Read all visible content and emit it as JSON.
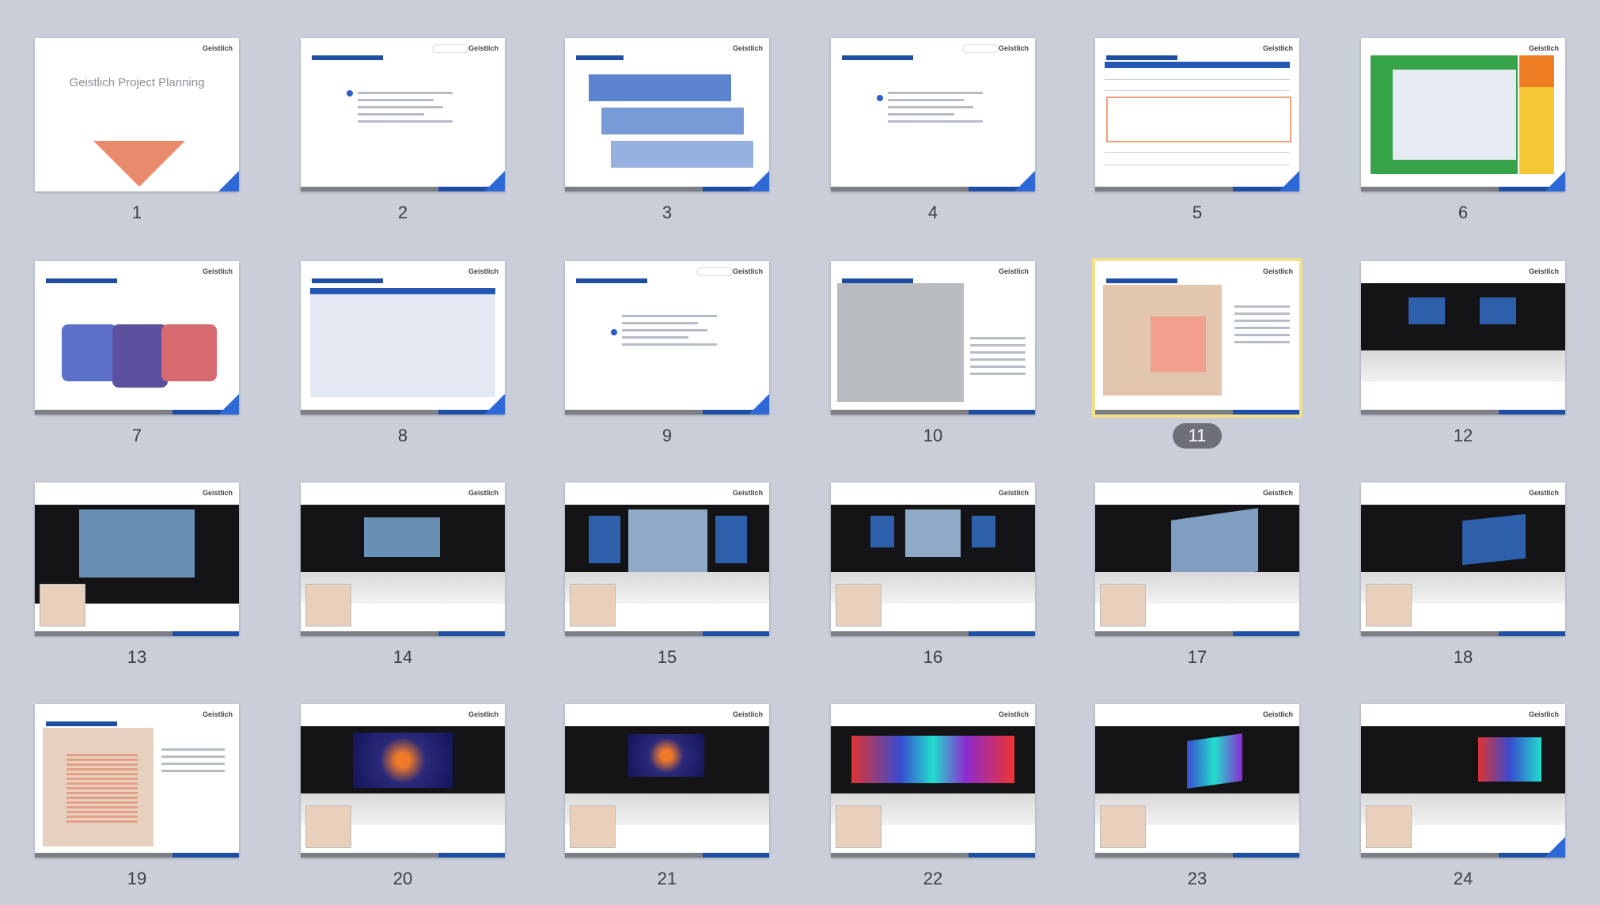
{
  "slides": [
    {
      "number": "1",
      "title": "Geistlich Project Planning",
      "logo": "Geistlich",
      "type": "title"
    },
    {
      "number": "2",
      "logo": "Geistlich",
      "type": "agenda"
    },
    {
      "number": "3",
      "logo": "Geistlich",
      "type": "steps"
    },
    {
      "number": "4",
      "logo": "Geistlich",
      "type": "agenda"
    },
    {
      "number": "5",
      "logo": "Geistlich",
      "type": "table"
    },
    {
      "number": "6",
      "logo": "Geistlich",
      "type": "colortable"
    },
    {
      "number": "7",
      "logo": "Geistlich",
      "type": "org"
    },
    {
      "number": "8",
      "logo": "Geistlich",
      "type": "table"
    },
    {
      "number": "9",
      "logo": "Geistlich",
      "type": "agenda"
    },
    {
      "number": "10",
      "logo": "Geistlich",
      "type": "map"
    },
    {
      "number": "11",
      "logo": "Geistlich",
      "type": "map-selected"
    },
    {
      "number": "12",
      "logo": "Geistlich",
      "type": "stage"
    },
    {
      "number": "13",
      "logo": "Geistlich",
      "type": "render"
    },
    {
      "number": "14",
      "logo": "Geistlich",
      "type": "render"
    },
    {
      "number": "15",
      "logo": "Geistlich",
      "type": "render"
    },
    {
      "number": "16",
      "logo": "Geistlich",
      "type": "render"
    },
    {
      "number": "17",
      "logo": "Geistlich",
      "type": "render"
    },
    {
      "number": "18",
      "logo": "Geistlich",
      "type": "render"
    },
    {
      "number": "19",
      "logo": "Geistlich",
      "type": "floorplan"
    },
    {
      "number": "20",
      "logo": "Geistlich",
      "type": "dinner"
    },
    {
      "number": "21",
      "logo": "Geistlich",
      "type": "dinner"
    },
    {
      "number": "22",
      "logo": "Geistlich",
      "type": "dinner"
    },
    {
      "number": "23",
      "logo": "Geistlich",
      "type": "dinner"
    },
    {
      "number": "24",
      "logo": "Geistlich",
      "type": "dinner"
    }
  ],
  "selected_slide": "11",
  "colors": {
    "accent": "#1d4fa6",
    "selection": "#f2e08a",
    "background": "#c9ced8"
  }
}
